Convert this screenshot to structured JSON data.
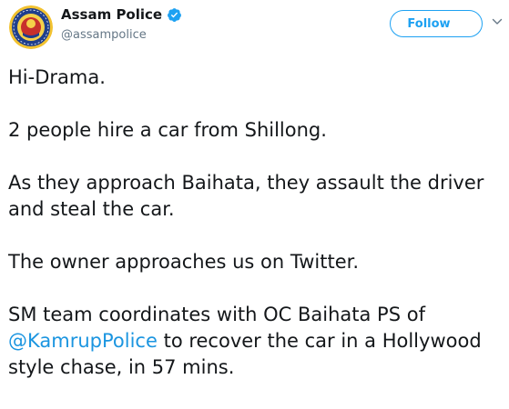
{
  "user": {
    "display_name": "Assam Police",
    "handle": "@assampolice",
    "verified": true
  },
  "follow_button": {
    "label": "Follow"
  },
  "icons": {
    "verified": "verified-badge-icon",
    "caret": "chevron-down-icon"
  },
  "colors": {
    "accent": "#1da1f2",
    "mention": "#1b95e0",
    "text": "#14171a",
    "secondary_text": "#657786"
  },
  "tweet": {
    "p1": "Hi-Drama.",
    "p2": "2 people hire a car from Shillong.",
    "p3": "As they approach Baihata, they assault the driver and steal the car.",
    "p4": "The owner approaches us on Twitter.",
    "p5_before": "SM team coordinates with OC Baihata PS of ",
    "p5_mention": "@KamrupPolice",
    "p5_after": " to recover the car in a Hollywood style chase, in 57 mins."
  }
}
